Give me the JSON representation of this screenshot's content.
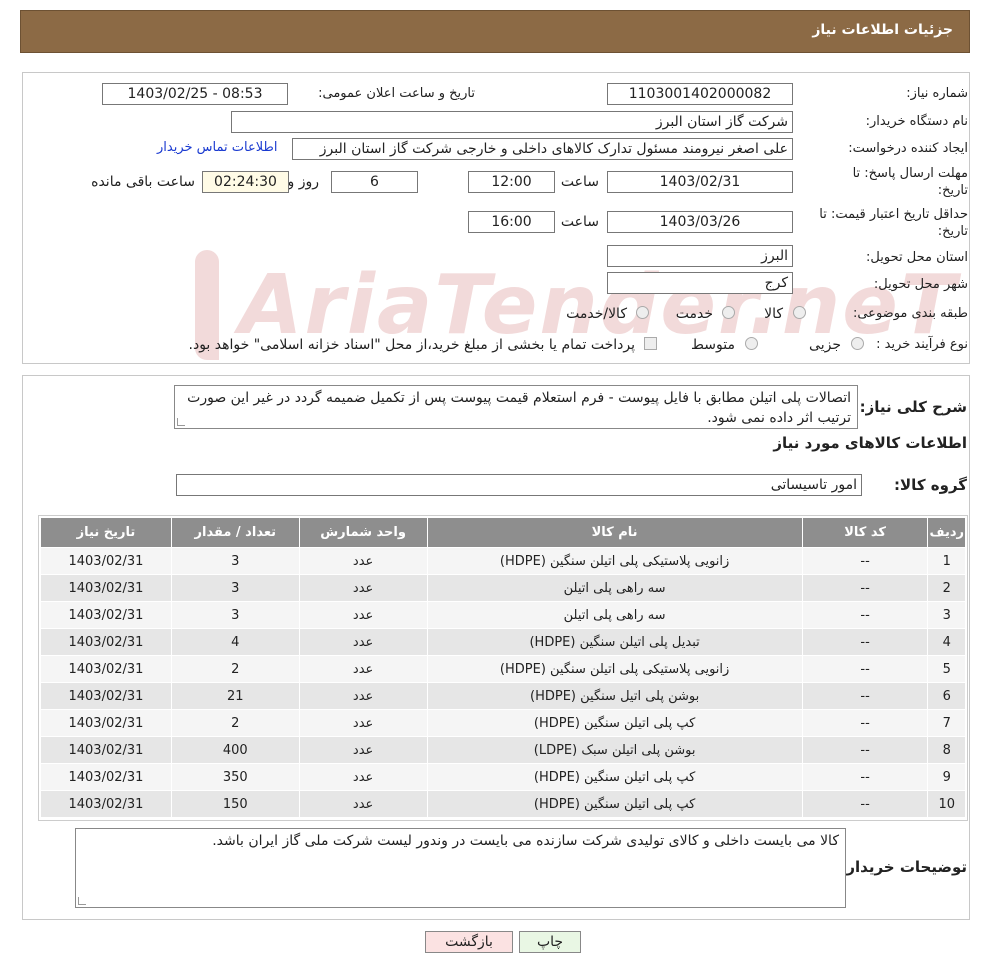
{
  "header": {
    "title": "جزئیات اطلاعات نیاز"
  },
  "info": {
    "need_number_label": "شماره نیاز:",
    "need_number": "1103001402000082",
    "announce_label": "تاریخ و ساعت اعلان عمومی:",
    "announce_value": "1403/02/25 - 08:53",
    "buyer_org_label": "نام دستگاه خریدار:",
    "buyer_org": "شرکت گاز استان البرز",
    "creator_label": "ایجاد کننده درخواست:",
    "creator": "علی اصغر نیرومند مسئول تدارک کالاهای داخلی و خارجی شرکت گاز استان البرز",
    "contact_link": "اطلاعات تماس خریدار",
    "deadline_label_1": "مهلت ارسال پاسخ: تا",
    "deadline_label_2": "تاریخ:",
    "deadline_date": "1403/02/31",
    "time_label": "ساعت",
    "deadline_time": "12:00",
    "days_value": "6",
    "days_label": "روز و",
    "remaining_time": "02:24:30",
    "remaining_label": "ساعت باقی مانده",
    "validity_label_1": "حداقل تاریخ اعتبار قیمت: تا",
    "validity_label_2": "تاریخ:",
    "validity_date": "1403/03/26",
    "validity_time_label": "ساعت",
    "validity_time": "16:00",
    "province_label": "استان محل تحویل:",
    "province": "البرز",
    "city_label": "شهر محل تحویل:",
    "city": "کرج",
    "category_label": "طبقه بندی موضوعی:",
    "category_options": [
      "کالا",
      "خدمت",
      "کالا/خدمت"
    ],
    "purchase_label": "نوع فرآیند خرید :",
    "purchase_options": [
      "جزیی",
      "متوسط"
    ],
    "purchase_note": "پرداخت تمام یا بخشی از مبلغ خرید،از محل \"اسناد خزانه اسلامی\" خواهد بود."
  },
  "description": {
    "label": "شرح کلی نیاز:",
    "text": "اتصالات پلی اتیلن مطابق با فایل پیوست - فرم استعلام قیمت پیوست پس از تکمیل ضمیمه گردد در غیر این صورت ترتیب اثر داده نمی شود."
  },
  "goods": {
    "section_title": "اطلاعات کالاهای مورد نیاز",
    "group_label": "گروه کالا:",
    "group_value": "امور تاسیساتی",
    "columns": [
      "ردیف",
      "کد کالا",
      "نام کالا",
      "واحد شمارش",
      "تعداد / مقدار",
      "تاریخ نیاز"
    ],
    "rows": [
      [
        "1",
        "--",
        "زانویی پلاستیکی پلی اتیلن سنگین (HDPE)",
        "عدد",
        "3",
        "1403/02/31"
      ],
      [
        "2",
        "--",
        "سه راهی پلی اتیلن",
        "عدد",
        "3",
        "1403/02/31"
      ],
      [
        "3",
        "--",
        "سه راهی پلی اتیلن",
        "عدد",
        "3",
        "1403/02/31"
      ],
      [
        "4",
        "--",
        "تبدیل پلی اتیلن سنگین (HDPE)",
        "عدد",
        "4",
        "1403/02/31"
      ],
      [
        "5",
        "--",
        "زانویی پلاستیکی پلی اتیلن سنگین (HDPE)",
        "عدد",
        "2",
        "1403/02/31"
      ],
      [
        "6",
        "--",
        "بوشن پلی اتیل سنگین (HDPE)",
        "عدد",
        "21",
        "1403/02/31"
      ],
      [
        "7",
        "--",
        "کپ پلی اتیلن سنگین (HDPE)",
        "عدد",
        "2",
        "1403/02/31"
      ],
      [
        "8",
        "--",
        "بوشن پلی اتیلن سبک (LDPE)",
        "عدد",
        "400",
        "1403/02/31"
      ],
      [
        "9",
        "--",
        "کپ پلی اتیلن سنگین (HDPE)",
        "عدد",
        "350",
        "1403/02/31"
      ],
      [
        "10",
        "--",
        "کپ پلی اتیلن سنگین (HDPE)",
        "عدد",
        "150",
        "1403/02/31"
      ]
    ]
  },
  "buyer_notes": {
    "label": "توضیحات خریدار:",
    "text": "کالا می بایست داخلی و کالای تولیدی شرکت سازنده می بایست در وندور لیست شرکت ملی گاز ایران باشد."
  },
  "buttons": {
    "print": "چاپ",
    "back": "بازگشت"
  },
  "watermark": "AriaTender.neT"
}
